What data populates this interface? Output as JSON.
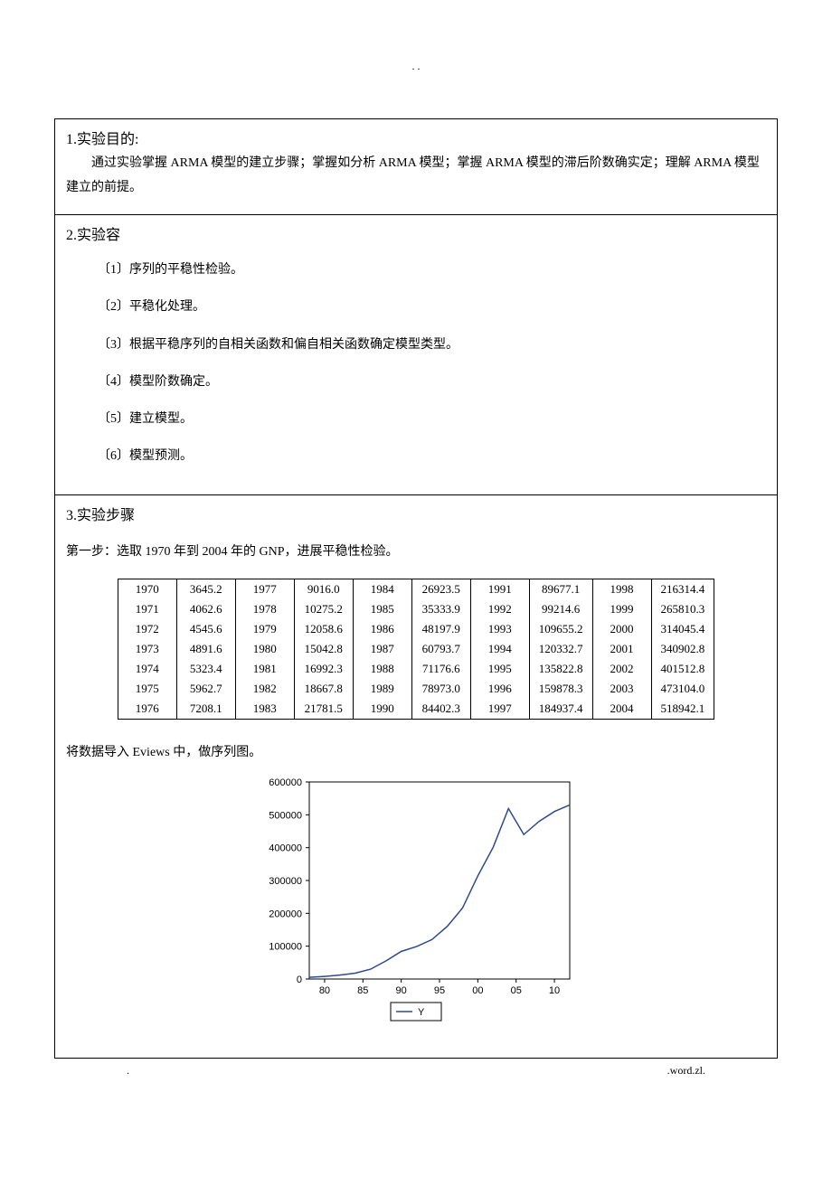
{
  "top_dots": ". .",
  "section1": {
    "heading": "1.实验目的:",
    "para": "通过实验掌握 ARMA 模型的建立步骤；掌握如分析 ARMA 模型；掌握 ARMA 模型的滞后阶数确实定；理解 ARMA 模型建立的前提。"
  },
  "section2": {
    "heading": "2.实验容",
    "items": [
      "〔1〕序列的平稳性检验。",
      "〔2〕平稳化处理。",
      "〔3〕根据平稳序列的自相关函数和偏自相关函数确定模型类型。",
      "〔4〕模型阶数确定。",
      "〔5〕建立模型。",
      "〔6〕模型预测。"
    ]
  },
  "section3": {
    "heading": "3.实验步骤",
    "step1": "第一步：选取 1970 年到 2004 年的 GNP，进展平稳性检验。",
    "table_rows": [
      [
        "1970",
        "3645.2",
        "1977",
        "9016.0",
        "1984",
        "26923.5",
        "1991",
        "89677.1",
        "1998",
        "216314.4"
      ],
      [
        "1971",
        "4062.6",
        "1978",
        "10275.2",
        "1985",
        "35333.9",
        "1992",
        "99214.6",
        "1999",
        "265810.3"
      ],
      [
        "1972",
        "4545.6",
        "1979",
        "12058.6",
        "1986",
        "48197.9",
        "1993",
        "109655.2",
        "2000",
        "314045.4"
      ],
      [
        "1973",
        "4891.6",
        "1980",
        "15042.8",
        "1987",
        "60793.7",
        "1994",
        "120332.7",
        "2001",
        "340902.8"
      ],
      [
        "1974",
        "5323.4",
        "1981",
        "16992.3",
        "1988",
        "71176.6",
        "1995",
        "135822.8",
        "2002",
        "401512.8"
      ],
      [
        "1975",
        "5962.7",
        "1982",
        "18667.8",
        "1989",
        "78973.0",
        "1996",
        "159878.3",
        "2003",
        "473104.0"
      ],
      [
        "1976",
        "7208.1",
        "1983",
        "21781.5",
        "1990",
        "84402.3",
        "1997",
        "184937.4",
        "2004",
        "518942.1"
      ]
    ],
    "chart_note": "将数据导入 Eviews 中，做序列图。"
  },
  "chart_data": {
    "type": "line",
    "x": [
      78,
      80,
      82,
      84,
      86,
      88,
      90,
      92,
      94,
      96,
      98,
      100,
      102,
      104,
      106,
      108,
      110,
      112
    ],
    "values": [
      5000,
      8000,
      12000,
      18000,
      30000,
      55000,
      84000,
      99000,
      120000,
      160000,
      216000,
      314000,
      401000,
      519000,
      440000,
      480000,
      510000,
      530000
    ],
    "title": "",
    "xlabel": "",
    "ylabel": "",
    "legend": "Y",
    "xlim": [
      78,
      112
    ],
    "ylim": [
      0,
      600000
    ],
    "yticks": [
      0,
      100000,
      200000,
      300000,
      400000,
      500000,
      600000
    ],
    "xticks": [
      80,
      85,
      90,
      95,
      100,
      105,
      110
    ],
    "xtick_labels": [
      "80",
      "85",
      "90",
      "95",
      "00",
      "05",
      "10"
    ]
  },
  "footer": {
    "left": ".",
    "right": ".word.zl."
  }
}
